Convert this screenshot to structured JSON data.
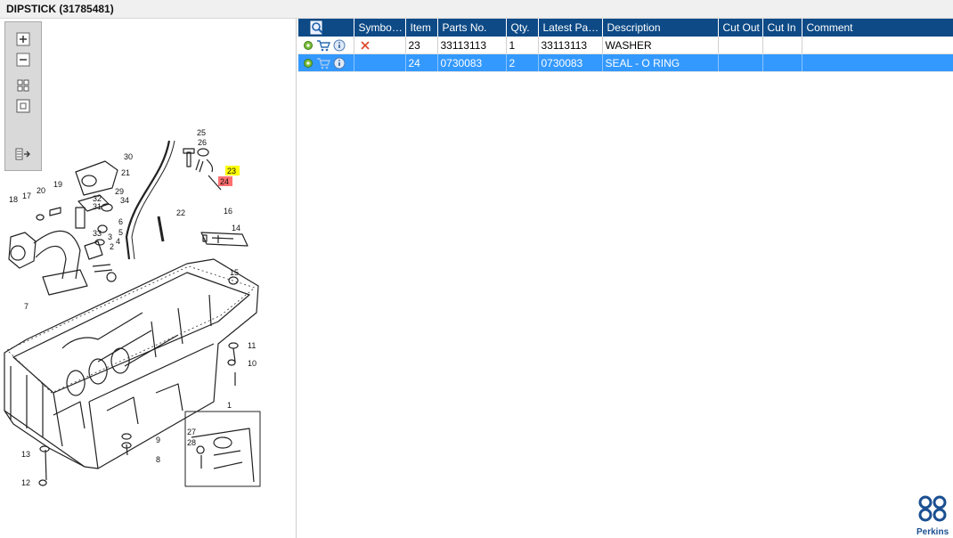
{
  "window": {
    "title": "DIPSTICK (31785481)"
  },
  "diagram": {
    "toolbar": [
      {
        "name": "zoom-in-icon"
      },
      {
        "name": "zoom-out-icon"
      },
      {
        "name": "fit-page-icon"
      },
      {
        "name": "actual-size-icon"
      },
      {
        "name": "show-parts-list-icon"
      }
    ],
    "callouts": [
      "25",
      "26",
      "23",
      "24",
      "30",
      "21",
      "19",
      "20",
      "17",
      "18",
      "32",
      "31",
      "29",
      "34",
      "22",
      "16",
      "14",
      "33",
      "3",
      "4",
      "6",
      "5",
      "2",
      "1",
      "7",
      "15",
      "11",
      "10",
      "27",
      "28",
      "9",
      "8",
      "13",
      "12"
    ],
    "highlight_colors": {
      "23": "#ffff00",
      "24": "#ff6b6b"
    }
  },
  "grid": {
    "columns": [
      {
        "label": ""
      },
      {
        "label": "Symbol(s)"
      },
      {
        "label": "Item"
      },
      {
        "label": "Parts No."
      },
      {
        "label": "Qty."
      },
      {
        "label": "Latest Part..."
      },
      {
        "label": "Description"
      },
      {
        "label": "Cut Out"
      },
      {
        "label": "Cut In"
      },
      {
        "label": "Comment"
      }
    ],
    "rows": [
      {
        "item": "23",
        "part_no": "33113113",
        "qty": "1",
        "latest_part": "33113113",
        "description": "WASHER",
        "cut_out": "",
        "cut_in": "",
        "comment": "",
        "symbol": "remove-x-icon",
        "selected": false
      },
      {
        "item": "24",
        "part_no": "0730083",
        "qty": "2",
        "latest_part": "0730083",
        "description": "SEAL - O RING",
        "cut_out": "",
        "cut_in": "",
        "comment": "",
        "symbol": "",
        "selected": true
      }
    ]
  },
  "brand": {
    "name": "Perkins",
    "color": "#1b4f91"
  },
  "colors": {
    "header_bg": "#0d4a86",
    "selected_row": "#3399ff"
  }
}
